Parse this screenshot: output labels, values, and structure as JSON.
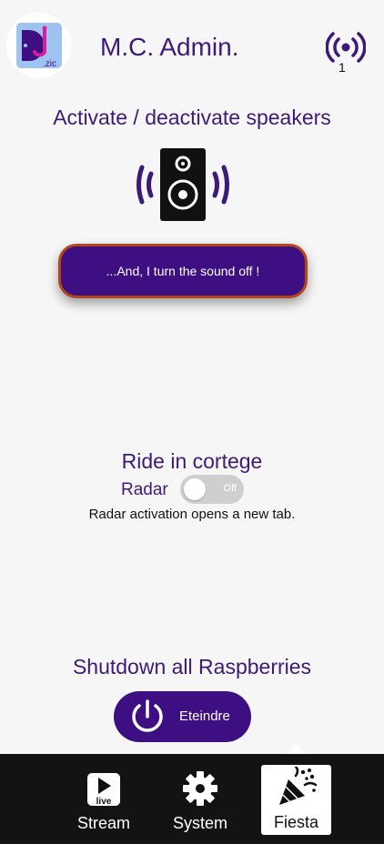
{
  "header": {
    "logo_text": ".zic",
    "title": "M.C. Admin.",
    "connected_count": "1"
  },
  "speakers": {
    "title": "Activate / deactivate speakers",
    "button_label": "...And, I turn the sound off !"
  },
  "cortege": {
    "title": "Ride in cortege",
    "radar_label": "Radar",
    "toggle_state": "Off",
    "note": "Radar activation opens a new tab."
  },
  "shutdown": {
    "title": "Shutdown all Raspberries",
    "button_label": "Eteindre"
  },
  "nav": {
    "items": [
      {
        "label": "Stream",
        "icon": "live-play-icon",
        "icon_text": "live"
      },
      {
        "label": "System",
        "icon": "gear-icon"
      },
      {
        "label": "Fiesta",
        "icon": "party-popper-icon",
        "active": true
      }
    ]
  },
  "colors": {
    "primary": "#3d0f82",
    "accent_border": "#b3471c",
    "title_text": "#3d1a78",
    "nav_bg": "#131313"
  }
}
